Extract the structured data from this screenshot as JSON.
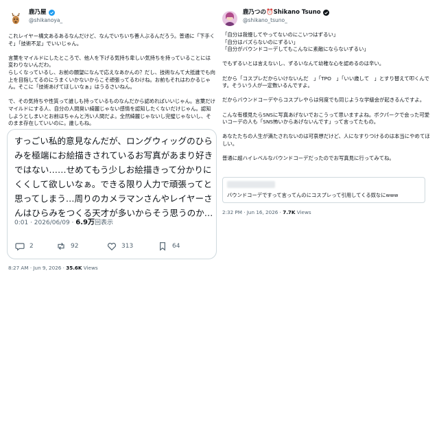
{
  "left": {
    "name": "鹿乃屋",
    "handle": "@shikanoya_",
    "text": "これレイヤー構文あるあるなんだけど、なんでいちいち善人ぶるんだろう。普通に「下手くそ」「技術不足」でいいじゃん。\n\n言葉をマイルドにしたところで、他人を下げる気持ち卑しい気持ちを持っていることには変わりないんだわ。\nらしくなっているし、お前の願望になんで応えなあかんの？だし、技術なんて大抵誰でも向上を目指してるのにうまくいかないからこそ頑張ってるわけね。お前もそれはわかるじゃん。そこに「技術あげてほしいなぁ」はうるさいねん。\n\nで、その気持ちや性質って誰しも持っているものなんだから認めればいいじゃん。言葉だけマイルドにする人、自分の人間臭い綺麗じゃない感情を認知したくないだけじゃん。認知しようとしまいとお前はちゃんと汚い人間だよ。全然綺麗じゃないし完璧じゃないし、そのまま存在していいのに。誰しもね。",
    "card": {
      "text": "すっごい私的意見なんだが、ロングウィッグのひらみを極端にお絵描きされているお写真があまり好きではない……せめてもう少しお絵描きって分かりにくくして欲しいなぁ。できる限り人力で頑張ってと思ってしまう…周りのカメラマンさんやレイヤーさんはひらみをつくる天才が多いからそう思うのか…",
      "time": "0:01 · 2026/06/09 · ",
      "views": "6.9万",
      "views_label": "回表示",
      "replies": "2",
      "reposts": "92",
      "likes": "313",
      "bookmarks": "64"
    },
    "footer_time": "8:27 AM · Jun 9, 2026 · ",
    "footer_views": "35.6K",
    "footer_views_label": " Views"
  },
  "right": {
    "name": "鹿乃つの⏰Shikano Tsuno",
    "handle": "@shikano_tsuno_",
    "text": "「自分は我慢してやってないのにこいつはずるい」\n「自分はバズらないのにずるい」\n「自分がバウンドコーデしてもこんなに素敵にならないずるい」\n\nでもずるいとは言えないし、ずるいなんて幼稚な心を認めるのは辛い。\n\nだから「コスプレだからいけないんだ　」「TPO　」「いい歳して　」とすり替えて叩くんです。そういう人が一定数いるんですよ。\n\nだからバウンドコーデやらコスプレやらは何度でも同じような学級会が起きるんですよ。\n\nこんな有様見たらSNSに写真あげないでおこうって思いますよね。ボクパークで会った可愛いコーデの人も「SNS怖いからあげないんです」って言ってたもの。\n\nあなたたちの人生が満たされないのは可哀想だけど、人になすりつけるのは本当にやめてほしい。\n\n普通に超ハイレベルなバウンドコーデだったのでお写真見に行ってみてね。",
    "quote_text": "バウンドコーデですって言ってんのにコスプレって引用してくる奴なにwww",
    "footer_time": "2:32 PM · Jun 16, 2026 · ",
    "footer_views": "7.7K",
    "footer_views_label": " Views"
  },
  "colors": {
    "verified": "#1d9bf0",
    "muted": "#536471",
    "border": "#cfd9de"
  },
  "icons": [
    "deer-avatar-icon",
    "verified-badge-icon",
    "reply-icon",
    "repost-icon",
    "like-icon",
    "bookmark-icon",
    "profile-avatar-icon"
  ]
}
